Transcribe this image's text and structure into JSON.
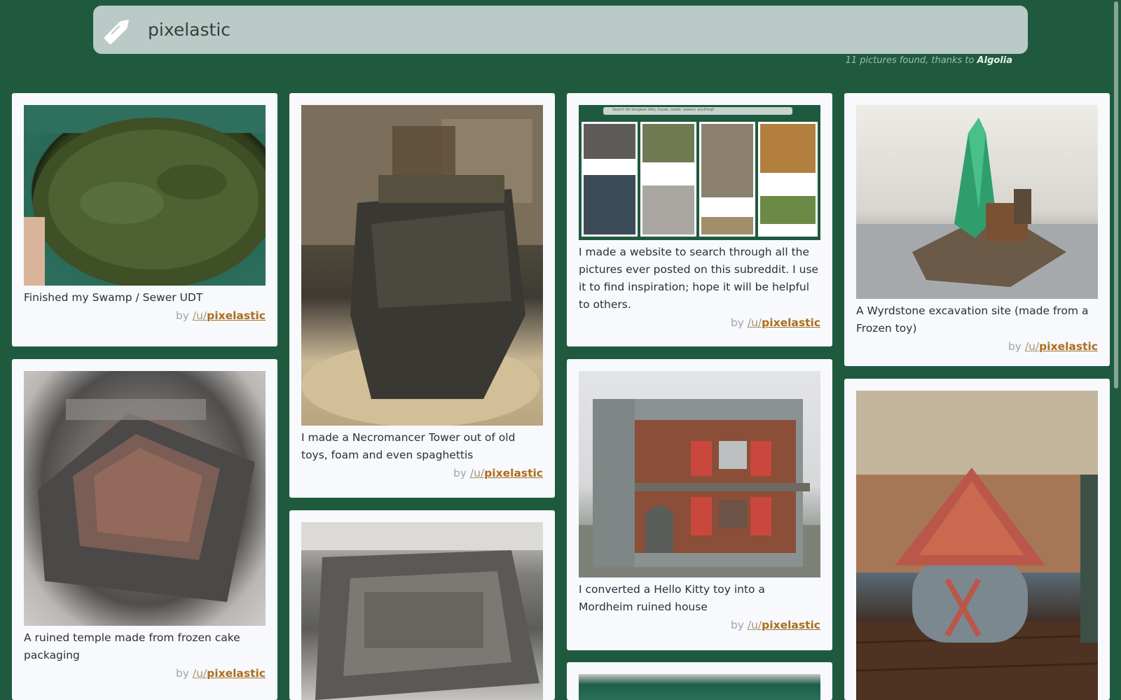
{
  "search": {
    "value": "pixelastic",
    "icon": "pen-icon"
  },
  "results": {
    "count_text": "11 pictures found, thanks to",
    "provider": "Algolia"
  },
  "byline": {
    "prefix": "by",
    "u": "/u/",
    "user": "pixelastic"
  },
  "cards": [
    {
      "title": "Finished my Swamp / Sewer UDT"
    },
    {
      "title": "I made a Necromancer Tower out of old toys, foam and even spaghettis"
    },
    {
      "title": "I made a website to search through all the pictures ever posted on this subreddit. I use it to find inspiration; hope it will be helpful to others."
    },
    {
      "title": "A Wyrdstone excavation site (made from a Frozen toy)"
    },
    {
      "title": "A ruined temple made from frozen cake packaging"
    },
    {
      "title": ""
    },
    {
      "title": "I converted a Hello Kitty toy into a Mordheim ruined house"
    },
    {
      "title": ""
    },
    {
      "title": ""
    }
  ],
  "screenshot_in_image": {
    "placeholder": "Search for dungeon tiles, house, castle, sewers, anything!"
  },
  "colors": {
    "background": "#1f5a3f",
    "card": "#f7f9fc",
    "search_bar": "#b9cac7",
    "username": "#a96d1e"
  }
}
